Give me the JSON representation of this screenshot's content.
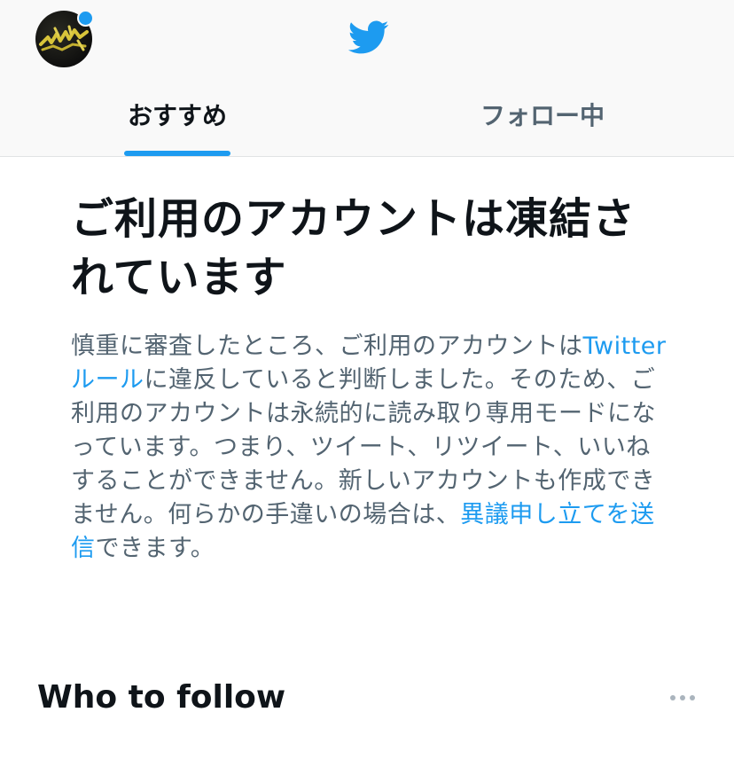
{
  "header": {
    "avatar_icon": "profile-avatar",
    "logo_icon": "twitter-bird-icon",
    "brand_color": "#1d9bf0"
  },
  "tabs": [
    {
      "label": "おすすめ",
      "active": true
    },
    {
      "label": "フォロー中",
      "active": false
    }
  ],
  "notice": {
    "title": "ご利用のアカウントは凍結されています",
    "body_1": "慎重に審査したところ、ご利用のアカウントは",
    "rules_link": "Twitterルール",
    "body_2": "に違反していると判断しました。そのため、ご利用のアカウントは永続的に読み取り専用モードになっています。つまり、ツイート、リツイート、いいねすることができません。新しいアカウントも作成できません。何らかの手違いの場合は、",
    "appeal_link": "異議申し立てを送信",
    "body_3": "できます。"
  },
  "who_to_follow": {
    "title": "Who to follow",
    "more_icon": "more-horizontal-icon"
  }
}
